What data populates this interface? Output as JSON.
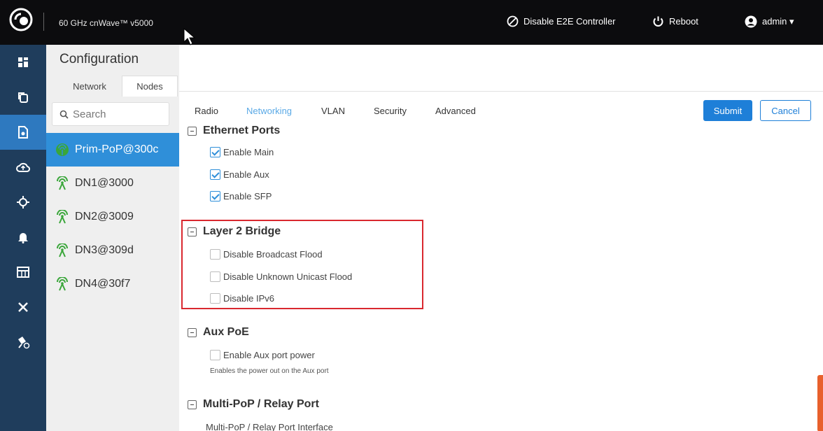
{
  "header": {
    "app_title": "60 GHz cnWave™ v5000",
    "disable_e2e_label": "Disable E2E Controller",
    "reboot_label": "Reboot",
    "user_label": "admin ▾"
  },
  "rail": {
    "icons": [
      "dashboard-icon",
      "copy-icon",
      "config-icon",
      "cloud-upload-icon",
      "crosshair-icon",
      "bell-icon",
      "table-icon",
      "tools-icon",
      "satellite-icon"
    ],
    "active_index": 2
  },
  "config": {
    "title": "Configuration",
    "tabs": {
      "network": "Network",
      "nodes": "Nodes"
    },
    "search_placeholder": "Search",
    "nodes": [
      {
        "label": "Prim-PoP@300c",
        "active": true
      },
      {
        "label": "DN1@3000",
        "active": false
      },
      {
        "label": "DN2@3009",
        "active": false
      },
      {
        "label": "DN3@309d",
        "active": false
      },
      {
        "label": "DN4@30f7",
        "active": false
      }
    ]
  },
  "main": {
    "tabs": {
      "radio": "Radio",
      "networking": "Networking",
      "vlan": "VLAN",
      "security": "Security",
      "advanced": "Advanced"
    },
    "active_tab": "Networking",
    "submit_label": "Submit",
    "cancel_label": "Cancel",
    "ethernet": {
      "title": "Ethernet Ports",
      "enable_main": "Enable Main",
      "enable_aux": "Enable Aux",
      "enable_sfp": "Enable SFP"
    },
    "layer2": {
      "title": "Layer 2 Bridge",
      "broadcast": "Disable Broadcast Flood",
      "unicast": "Disable Unknown Unicast Flood",
      "ipv6": "Disable IPv6"
    },
    "auxpoe": {
      "title": "Aux PoE",
      "enable_power": "Enable Aux port power",
      "hint": "Enables the power out on the Aux port"
    },
    "multipop": {
      "title": "Multi-PoP / Relay Port",
      "interface_label": "Multi-PoP / Relay Port Interface"
    }
  },
  "colors": {
    "topbar": "#0c0c0e",
    "rail": "#1f3d5c",
    "rail_active": "#2e79bf",
    "node_active": "#2f8fd9",
    "accent": "#1e7fd8",
    "node_icon": "#3aa63a",
    "highlight": "#d9282f"
  }
}
